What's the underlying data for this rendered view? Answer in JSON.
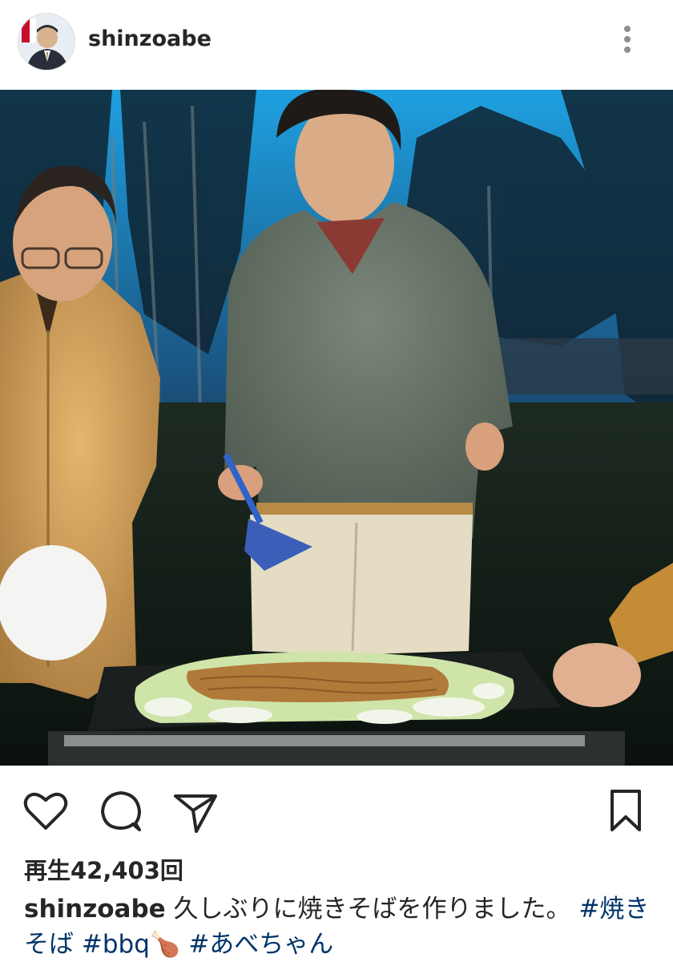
{
  "header": {
    "username": "shinzoabe",
    "avatar_icon": "profile-photo",
    "more_icon": "more-vertical-icon"
  },
  "post": {
    "media_type": "video-thumbnail",
    "scene_description_icon": "outdoor-bbq-yakisoba-scene"
  },
  "actions": {
    "like_icon": "heart-icon",
    "comment_icon": "comment-bubble-icon",
    "share_icon": "paper-plane-icon",
    "save_icon": "bookmark-icon"
  },
  "stats": {
    "views": "再生42,403回"
  },
  "caption": {
    "username": "shinzoabe",
    "text": " 久しぶりに焼きそばを作りました。",
    "hashtag1": "#焼きそば",
    "hashtag2": "#bbq🍗",
    "hashtag3": "#あべちゃん"
  },
  "colors": {
    "text": "#262626",
    "hashtag": "#003569",
    "background": "#ffffff"
  }
}
